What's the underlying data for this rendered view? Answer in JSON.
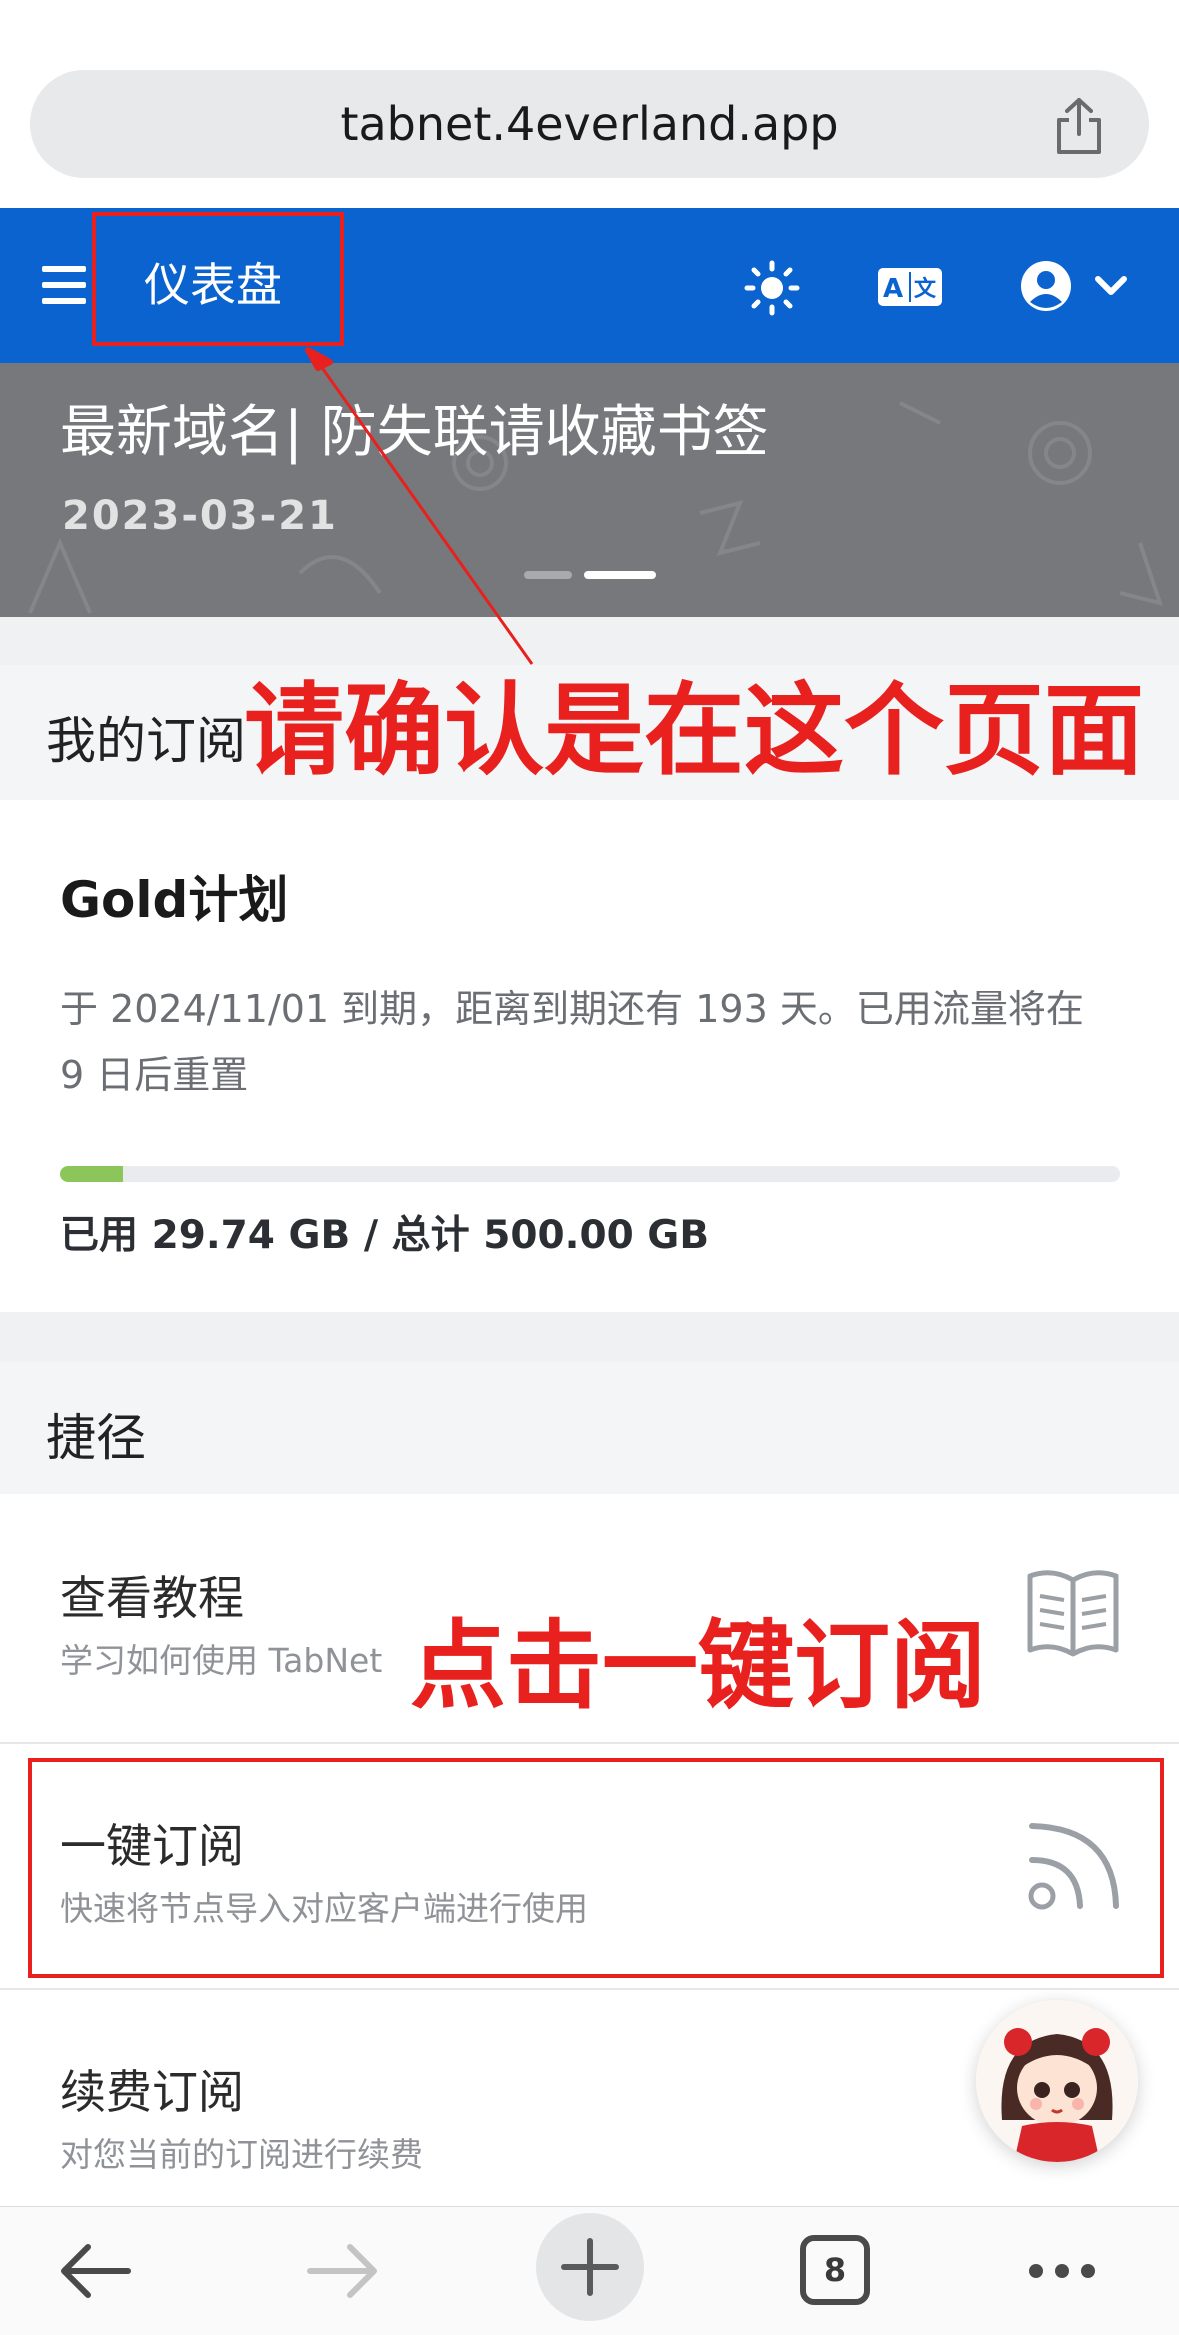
{
  "browser": {
    "url": "tabnet.4everland.app",
    "tab_count": "8"
  },
  "header": {
    "title": "仪表盘"
  },
  "banner": {
    "title": "最新域名| 防失联请收藏书签",
    "date": "2023-03-21"
  },
  "subscription": {
    "section_label": "我的订阅",
    "plan_name": "Gold计划",
    "description": "于 2024/11/01 到期，距离到期还有 193 天。已用流量将在 9 日后重置",
    "usage_text": "已用 29.74 GB / 总计 500.00 GB",
    "used_gb": 29.74,
    "total_gb": 500.0,
    "progress_fraction": 0.0595,
    "progress_color": "#8cc65a"
  },
  "shortcuts": {
    "section_label": "捷径",
    "items": [
      {
        "title": "查看教程",
        "desc": "学习如何使用 TabNet",
        "icon": "book-icon"
      },
      {
        "title": "一键订阅",
        "desc": "快速将节点导入对应客户端进行使用",
        "icon": "rss-icon"
      },
      {
        "title": "续费订阅",
        "desc": "对您当前的订阅进行续费",
        "icon": ""
      }
    ]
  },
  "annotations": {
    "confirm_page": "请确认是在这个页面",
    "click_subscribe": "点击一键订阅",
    "color": "#e8201e"
  },
  "colors": {
    "header_blue": "#0a63cf",
    "banner_gray": "#76787b"
  }
}
